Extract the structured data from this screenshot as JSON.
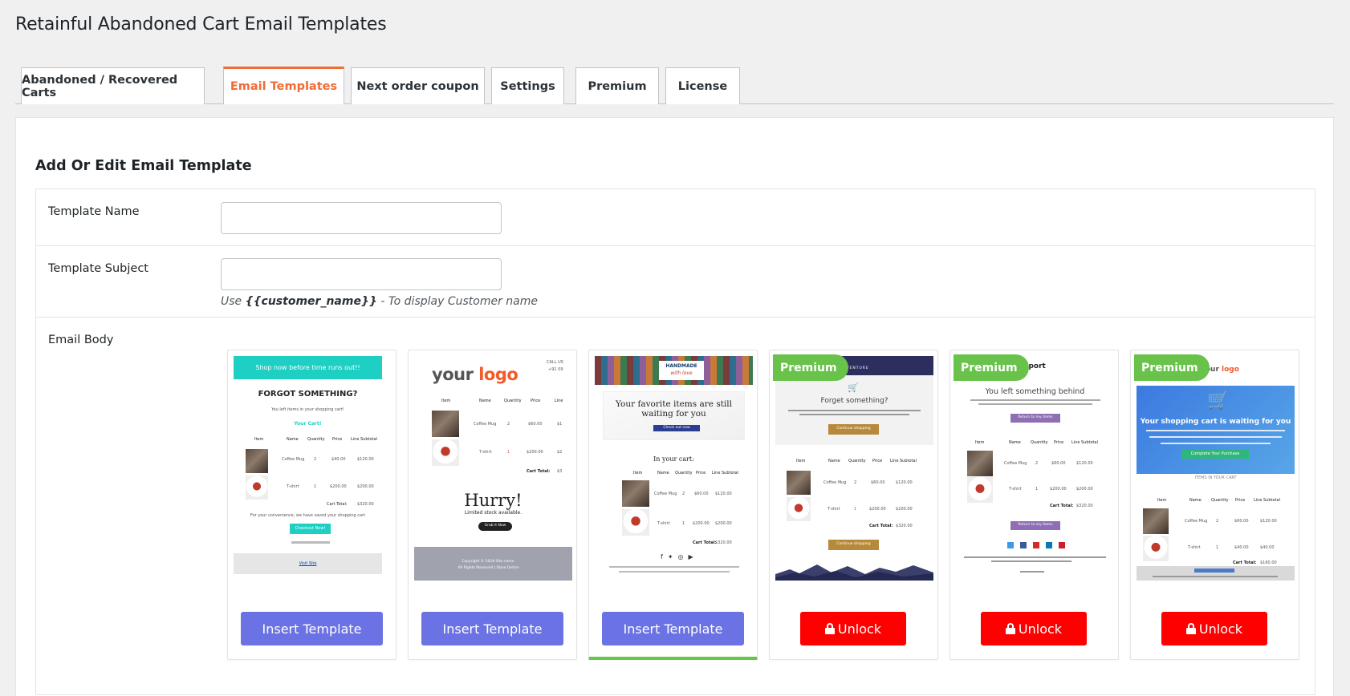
{
  "page_title": "Retainful Abandoned Cart Email Templates",
  "tabs": [
    {
      "label": "Abandoned / Recovered Carts",
      "active": false
    },
    {
      "label": "Email Templates",
      "active": true
    },
    {
      "label": "Next order coupon",
      "active": false
    },
    {
      "label": "Settings",
      "active": false
    },
    {
      "label": "Premium",
      "active": false
    },
    {
      "label": "License",
      "active": false
    }
  ],
  "section_title": "Add Or Edit Email Template",
  "form": {
    "template_name_label": "Template Name",
    "template_name_value": "",
    "template_subject_label": "Template Subject",
    "template_subject_value": "",
    "subject_hint_prefix": "Use ",
    "subject_hint_token": "{{customer_name}}",
    "subject_hint_suffix": " - To display Customer name",
    "email_body_label": "Email Body"
  },
  "templates": {
    "insert_label": "Insert Template",
    "unlock_label": "Unlock",
    "premium_badge": "Premium",
    "t1": {
      "banner": "Shop now before time runs out!!",
      "heading": "FORGOT SOMETHING?",
      "sub": "You left items in your shopping cart!",
      "cart": "Your Cart!",
      "cols": [
        "Item",
        "Name",
        "Quantity",
        "Price",
        "Line Subtotal"
      ],
      "r1": [
        "Coffee Mug",
        "2",
        "$40.00",
        "$120.00"
      ],
      "r2": [
        "T-shirt",
        "1",
        "$200.00",
        "$200.00"
      ],
      "total": "Cart Total:",
      "total_val": "$320.00",
      "note": "For your convenience, we have saved your shopping cart",
      "cta": "Checkout Now!",
      "footer_link": "Visit Site"
    },
    "t2": {
      "logo_a": "your ",
      "logo_b": "logo",
      "call": "CALL US",
      "phone": "+91 09",
      "cols": [
        "Item",
        "Name",
        "Quantity",
        "Price",
        "Line"
      ],
      "r1": [
        "Coffee Mug",
        "2",
        "$60.00",
        "$1"
      ],
      "r2": [
        "T-shirt",
        "1",
        "$200.00",
        "$2"
      ],
      "total": "Cart Total:",
      "total_val": "$3",
      "hurry": "Hurry!",
      "stock": "Limited stock available.",
      "cta": "Grab it Now",
      "footer1": "Copyright © 2018 Site name.",
      "footer2": "All Rights Reserved  |  Store Online"
    },
    "t3": {
      "brand1": "HANDMADE",
      "brand2": "with love",
      "headline1": "Your favorite items are still",
      "headline2": "waiting for you",
      "cta": "Check out now",
      "incart": "In your cart:",
      "cols": [
        "Item",
        "Name",
        "Quantity",
        "Price",
        "Line Subtotal"
      ],
      "r1": [
        "Coffee Mug",
        "2",
        "$60.00",
        "$120.00"
      ],
      "r2": [
        "T-shirt",
        "1",
        "$200.00",
        "$200.00"
      ],
      "total": "Cart Total:",
      "total_val": "$320.00"
    },
    "t4": {
      "brand": "ADVENTURE",
      "heading": "Forget something?",
      "cta": "Continue shopping",
      "cols": [
        "Item",
        "Name",
        "Quantity",
        "Price",
        "Line Subtotal"
      ],
      "r1": [
        "Coffee Mug",
        "2",
        "$60.00",
        "$120.00"
      ],
      "r2": [
        "T-shirt",
        "1",
        "$200.00",
        "$200.00"
      ],
      "total": "Cart Total:",
      "total_val": "$320.00"
    },
    "t5": {
      "brand": "Sport",
      "heading": "You left something behind",
      "cta": "Return to my items",
      "cols": [
        "Item",
        "Name",
        "Quantity",
        "Price",
        "Line Subtotal"
      ],
      "r1": [
        "Coffee Mug",
        "2",
        "$60.00",
        "$120.00"
      ],
      "r2": [
        "T-shirt",
        "1",
        "$200.00",
        "$200.00"
      ],
      "total": "Cart Total:",
      "total_val": "$320.00"
    },
    "t6": {
      "logo_a": "your ",
      "logo_b": "logo",
      "heading": "Your shopping cart is waiting for you",
      "cta": "Complete Your Purchase",
      "items_label": "ITEMS IN YOUR CART",
      "cols": [
        "Item",
        "Name",
        "Quantity",
        "Price",
        "Line Subtotal"
      ],
      "r1": [
        "Coffee Mug",
        "2",
        "$60.00",
        "$120.00"
      ],
      "r2": [
        "T-shirt",
        "1",
        "$40.00",
        "$40.00"
      ],
      "total": "Cart Total:",
      "total_val": "$160.00"
    }
  },
  "colors": {
    "accent_tab": "#f26b34",
    "insert_button": "#6b72e3",
    "unlock_button": "#ff0000",
    "premium_badge": "#69c24a",
    "selected_border": "#68c549"
  }
}
